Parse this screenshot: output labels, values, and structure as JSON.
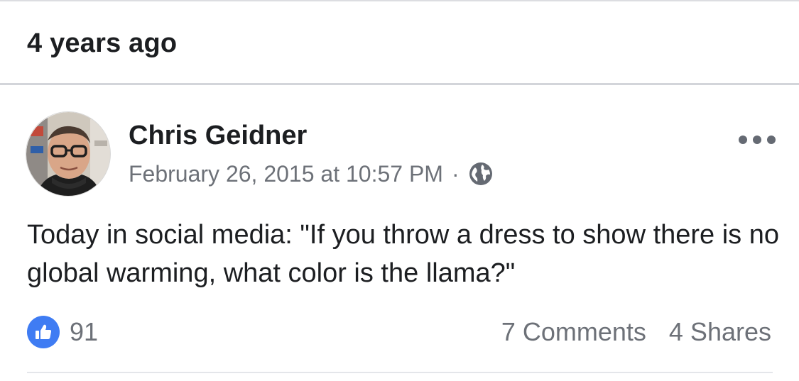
{
  "memory": {
    "label": "4 years ago"
  },
  "post": {
    "author": "Chris Geidner",
    "timestamp": "February 26, 2015 at 10:57 PM",
    "separator": "·",
    "privacy_icon": "globe-icon",
    "text": "Today in social media: \"If you throw a dress to show there is no global warming, what color is the llama?\"",
    "reactions": {
      "icon": "thumbs-up-icon",
      "count": "91"
    },
    "comments_label": "7 Comments",
    "shares_label": "4 Shares",
    "more_icon": "more-options-icon"
  },
  "colors": {
    "like_blue": "#3f7cf3",
    "secondary_text": "#6d7178",
    "primary_text": "#1c1e21",
    "divider": "#d3d5da"
  }
}
